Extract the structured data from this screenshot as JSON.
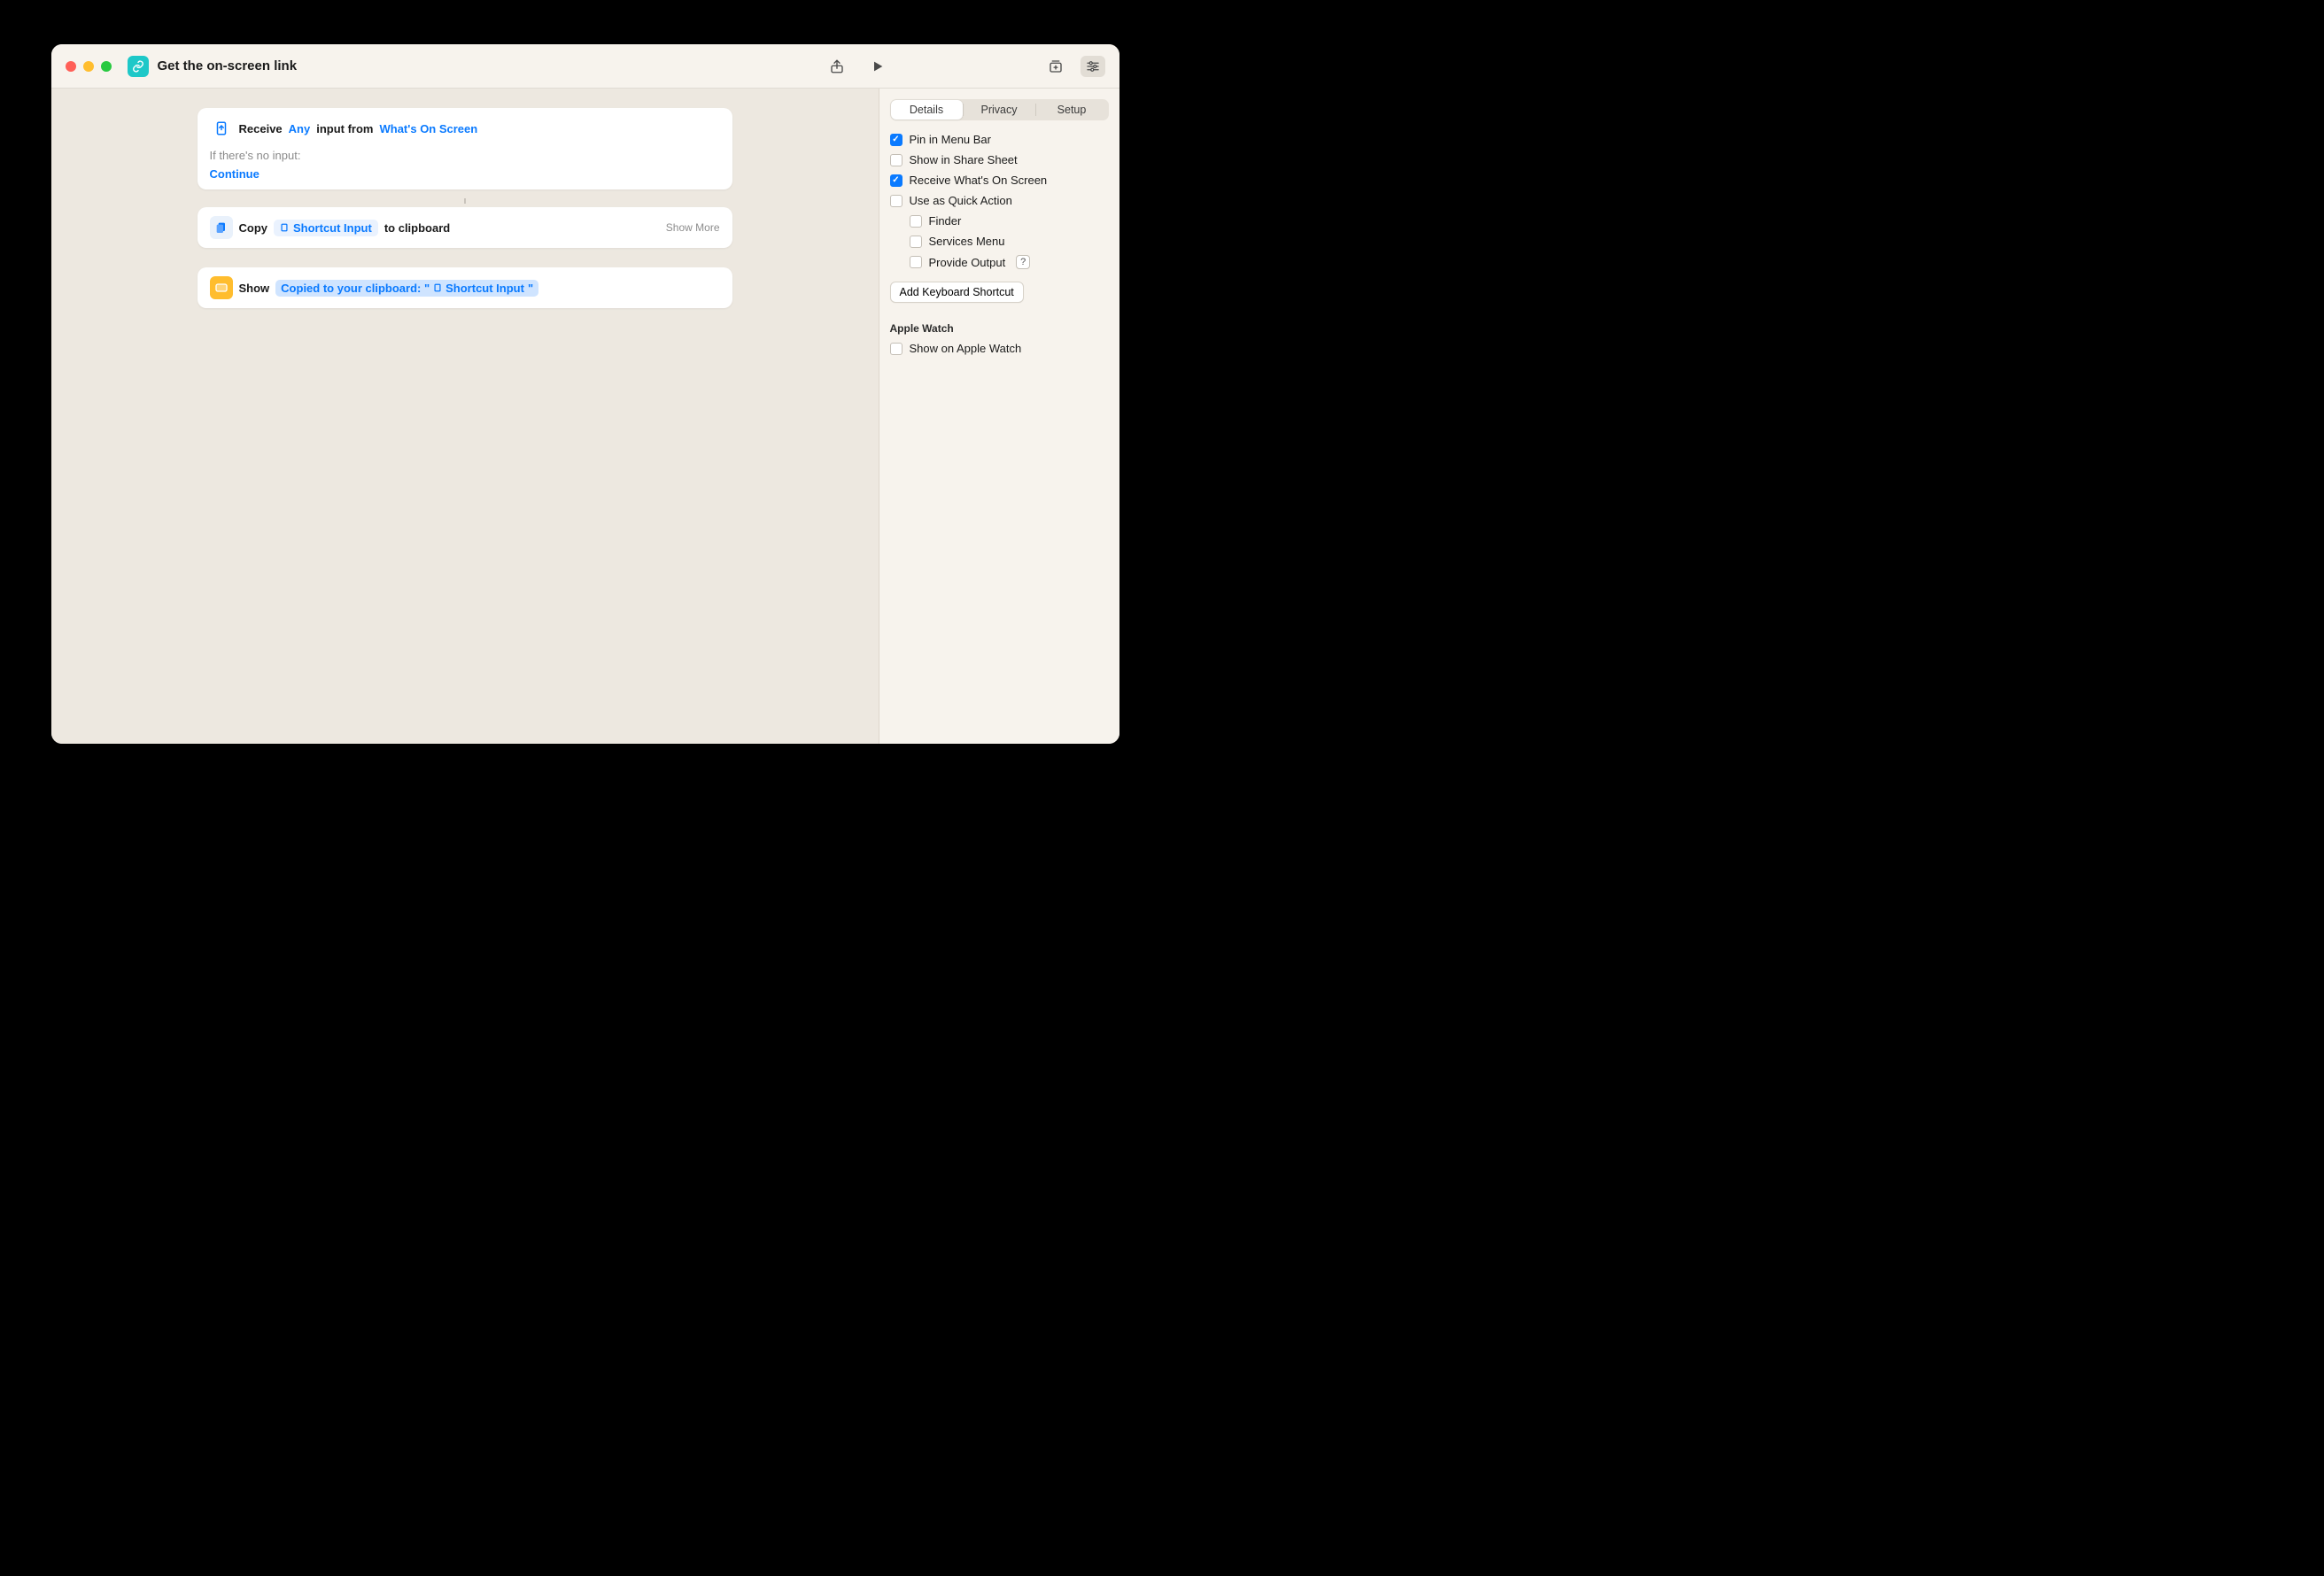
{
  "window": {
    "title": "Get the on-screen link"
  },
  "actions": {
    "receive": {
      "label": "Receive",
      "type_token": "Any",
      "input_from": "input from",
      "source_token": "What's On Screen",
      "no_input_label": "If there's no input:",
      "continue": "Continue"
    },
    "copy": {
      "label": "Copy",
      "token": "Shortcut Input",
      "suffix": "to clipboard",
      "show_more": "Show More"
    },
    "show": {
      "label": "Show",
      "notification_prefix": "Copied to your clipboard: \"",
      "notification_token": "Shortcut Input",
      "notification_suffix": "\""
    }
  },
  "inspector": {
    "tabs": {
      "details": "Details",
      "privacy": "Privacy",
      "setup": "Setup"
    },
    "checks": {
      "pin_menu_bar": "Pin in Menu Bar",
      "share_sheet": "Show in Share Sheet",
      "receive_screen": "Receive What's On Screen",
      "quick_action": "Use as Quick Action",
      "finder": "Finder",
      "services_menu": "Services Menu",
      "provide_output": "Provide Output"
    },
    "add_keyboard": "Add Keyboard Shortcut",
    "apple_watch_header": "Apple Watch",
    "show_on_watch": "Show on Apple Watch",
    "help": "?"
  }
}
